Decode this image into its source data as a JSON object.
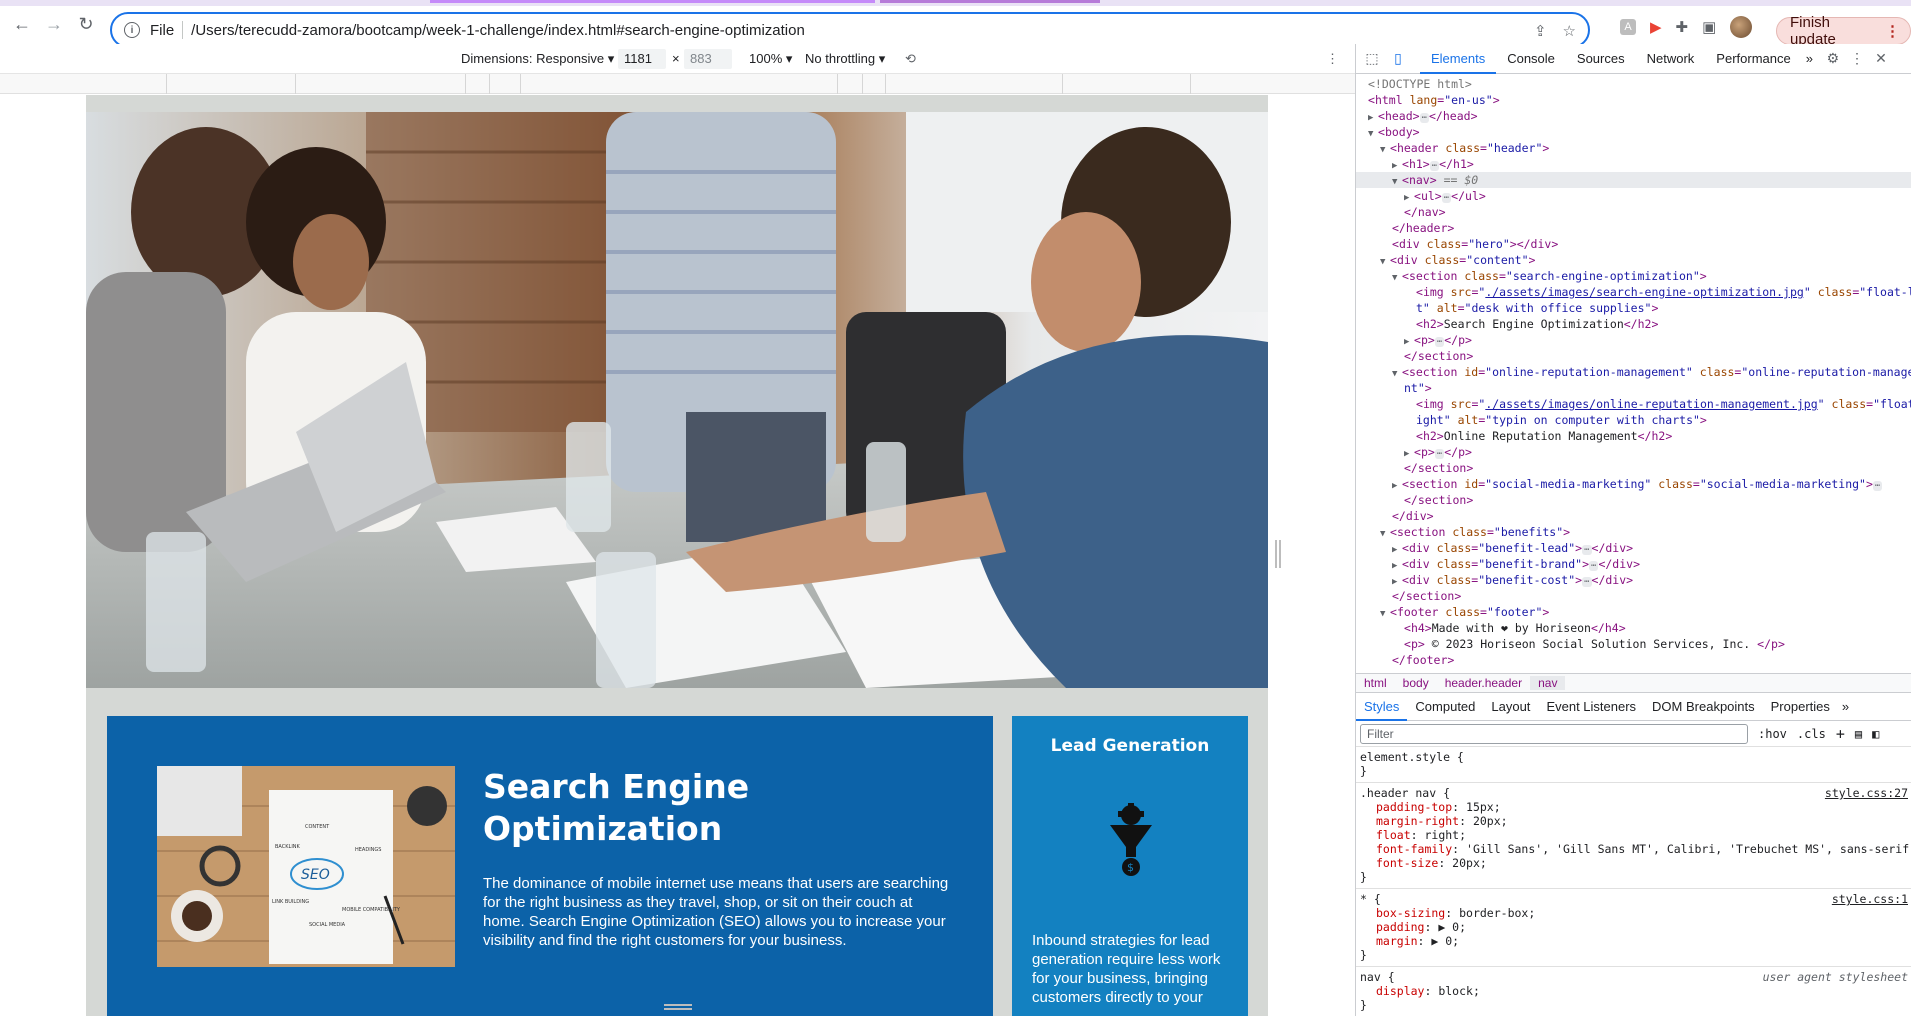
{
  "browser": {
    "scheme": "File",
    "url": "/Users/terecudd-zamora/bootcamp/week-1-challenge/index.html#search-engine-optimization",
    "finish_update": "Finish update"
  },
  "device_toolbar": {
    "dimensions": "Dimensions: Responsive",
    "width": "1181",
    "times": "×",
    "height": "883",
    "zoom": "100%",
    "throttling": "No throttling"
  },
  "page": {
    "seo_heading": "Search Engine Optimization",
    "seo_text": "The dominance of mobile internet use means that users are searching for the right business as they travel, shop, or sit on their couch at home. Search Engine Optimization (SEO) allows you to increase your visibility and find the right customers for your business.",
    "lead_heading": "Lead Generation",
    "lead_text": "Inbound strategies for lead generation require less work for your business, bringing customers directly to your",
    "seo_image_words": {
      "seo": "SEO",
      "content": "CONTENT",
      "backlink": "BACKLINK",
      "headings": "HEADINGS",
      "link_building": "LINK BUILDING",
      "mobile": "MOBILE COMPATIBILITY",
      "social": "SOCIAL MEDIA"
    }
  },
  "devtools": {
    "tabs": [
      "Elements",
      "Console",
      "Sources",
      "Network",
      "Performance"
    ],
    "more_tabs": "»",
    "dom": {
      "l0": "<!DOCTYPE html>",
      "html_open": "html",
      "lang_attr": "lang",
      "lang_val": "\"en-us\"",
      "head": "head",
      "body": "body",
      "header": "header",
      "class": "class",
      "header_class": "\"header\"",
      "h1": "h1",
      "nav": "nav",
      "nav_marker": "== $0",
      "ul": "ul",
      "div": "div",
      "hero_class": "\"hero\"",
      "content_class": "\"content\"",
      "section": "section",
      "seo_class": "\"search-engine-optimization\"",
      "img": "img",
      "src": "src",
      "seo_src": "./assets/images/search-engine-optimization.jpg",
      "float_left_a": "\"float-lef",
      "float_left_b": "t\"",
      "alt": "alt",
      "seo_alt": "\"desk with office supplies\"",
      "h2": "h2",
      "seo_h2": "Search Engine Optimization",
      "p": "p",
      "id": "id",
      "orm_id": "\"online-reputation-management\"",
      "orm_class_a": "\"online-reputation-manageme",
      "orm_class_b": "nt\"",
      "orm_src": "./assets/images/online-reputation-management.jpg",
      "float_right_a": "\"float-r",
      "float_right_b": "ight\"",
      "orm_alt": "\"typin on computer with charts\"",
      "orm_h2": "Online Reputation Management",
      "smm_id": "\"social-media-marketing\"",
      "smm_class": "\"social-media-marketing\"",
      "benefits_class": "\"benefits\"",
      "lead_class": "\"benefit-lead\"",
      "brand_class": "\"benefit-brand\"",
      "cost_class": "\"benefit-cost\"",
      "footer": "footer",
      "footer_class": "\"footer\"",
      "h4": "h4",
      "made_with": "Made with ❤ by Horiseon",
      "copyright": " © 2023 Horiseon Social Solution Services, Inc. ",
      "ell": "⋯"
    },
    "breadcrumbs": [
      "html",
      "body",
      "header.header",
      "nav"
    ],
    "subtabs": [
      "Styles",
      "Computed",
      "Layout",
      "Event Listeners",
      "DOM Breakpoints",
      "Properties"
    ],
    "filter_placeholder": "Filter",
    "hov": ":hov",
    "cls": ".cls",
    "styles": {
      "element_style": "element.style {",
      "close": "}",
      "r1_selector": ".header nav {",
      "r1_source": "style.css:27",
      "r1_props": [
        {
          "name": "padding-top",
          "value": "15px;"
        },
        {
          "name": "margin-right",
          "value": "20px;"
        },
        {
          "name": "float",
          "value": "right;"
        },
        {
          "name": "font-family",
          "value": "'Gill Sans', 'Gill Sans MT', Calibri, 'Trebuchet MS', sans-serif;"
        },
        {
          "name": "font-size",
          "value": "20px;"
        }
      ],
      "r2_selector": "* {",
      "r2_source": "style.css:1",
      "r2_props": [
        {
          "name": "box-sizing",
          "value": "border-box;"
        },
        {
          "name": "padding",
          "value": "▶ 0;"
        },
        {
          "name": "margin",
          "value": "▶ 0;"
        }
      ],
      "r3_selector": "nav {",
      "r3_source": "user agent stylesheet",
      "r3_props": [
        {
          "name": "display",
          "value": "block;"
        }
      ]
    }
  },
  "colors": {
    "accent": "#1a73e8",
    "seo_card": "#0c62a8",
    "lead_card": "#1381c1",
    "page_bg": "#d5d8d5"
  }
}
